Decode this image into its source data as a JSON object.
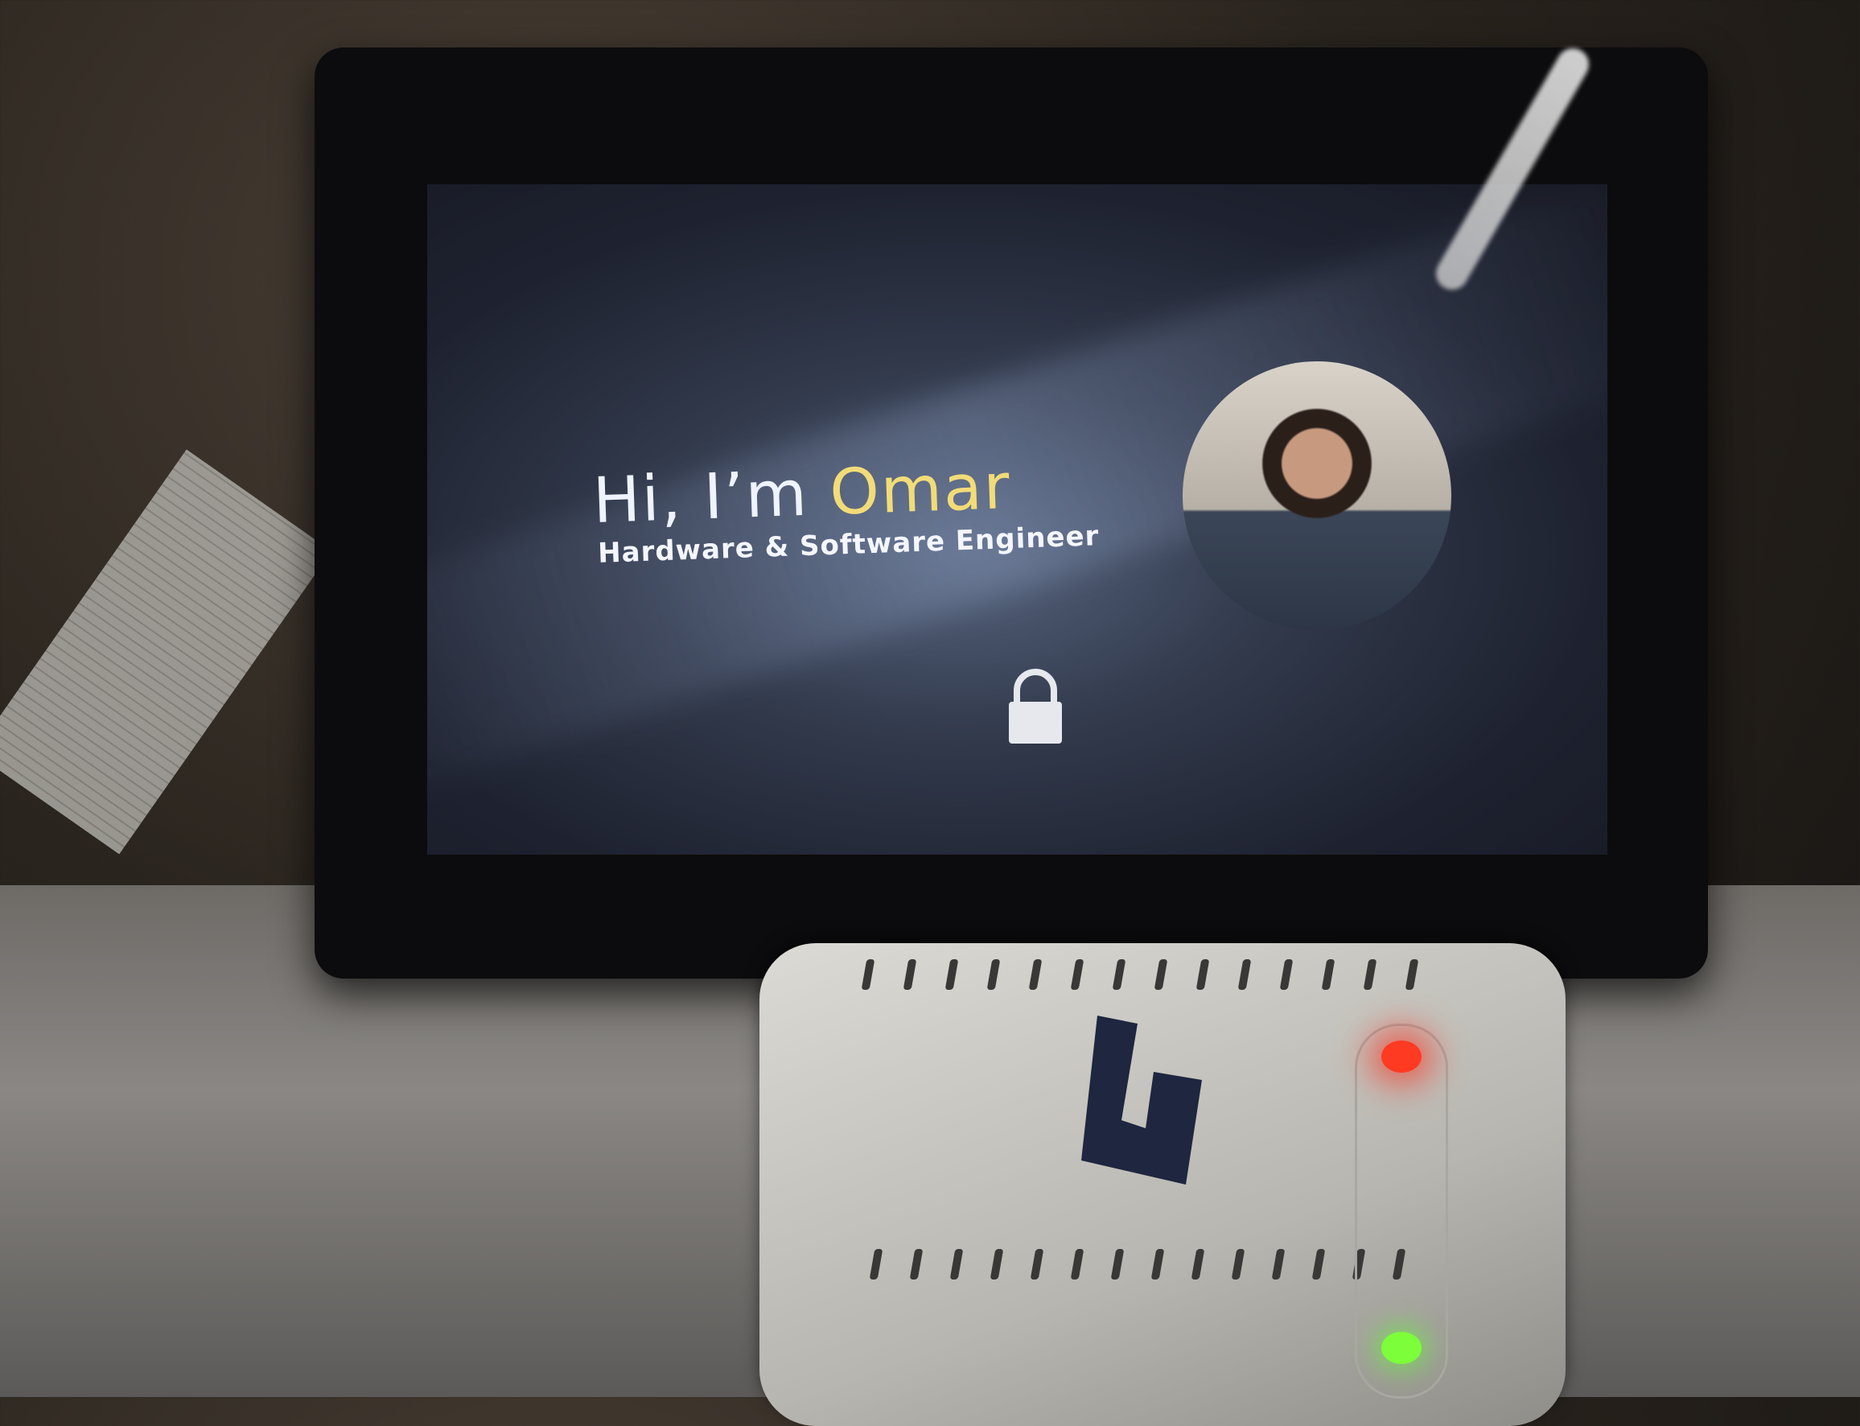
{
  "screen": {
    "greeting_prefix": "Hi, I’m ",
    "greeting_name": "Omar",
    "subtitle": "Hardware & Software Engineer",
    "icons": [
      "profile-photo",
      "lock-icon"
    ],
    "colors": {
      "name_accent": "#f2dc78",
      "text": "#eef3ff",
      "background": "#2a3142"
    }
  },
  "device": {
    "leds": [
      {
        "color": "red",
        "on": true
      },
      {
        "color": "green",
        "on": true
      }
    ]
  }
}
